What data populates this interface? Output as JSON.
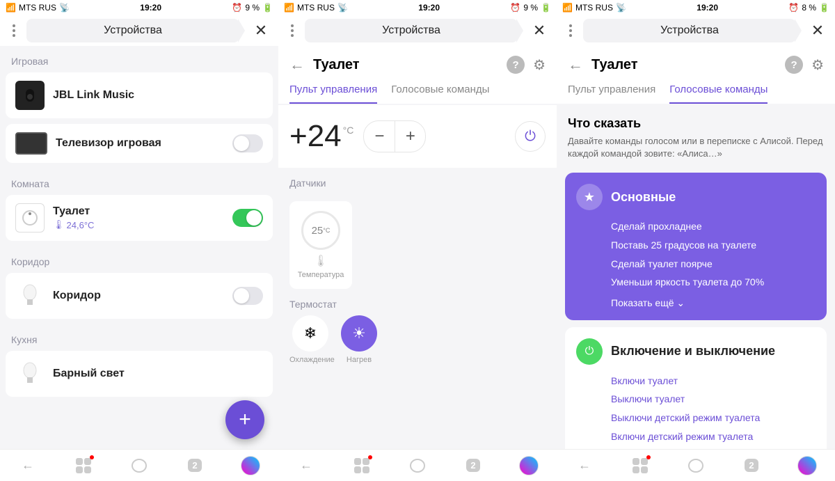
{
  "status": {
    "carrier": "MTS RUS",
    "time": "19:20",
    "battery1": "9 %",
    "battery2": "9 %",
    "battery3": "8 %"
  },
  "header": {
    "title": "Устройства"
  },
  "s1": {
    "groups": [
      {
        "label": "Игровая",
        "items": [
          {
            "name": "JBL Link Music",
            "icon": "speaker",
            "toggle": null
          },
          {
            "name": "Телевизор игровая",
            "icon": "tv",
            "toggle": false
          }
        ]
      },
      {
        "label": "Комната",
        "items": [
          {
            "name": "Туалет",
            "icon": "dial",
            "sub": "24,6°C",
            "toggle": true
          }
        ]
      },
      {
        "label": "Коридор",
        "items": [
          {
            "name": "Коридор",
            "icon": "bulb",
            "toggle": false
          }
        ]
      },
      {
        "label": "Кухня",
        "items": [
          {
            "name": "Барный свет",
            "icon": "bulb",
            "toggle": null
          }
        ]
      }
    ]
  },
  "s2": {
    "title": "Туалет",
    "tabs": {
      "remote": "Пульт управления",
      "voice": "Голосовые команды",
      "active": "remote"
    },
    "temp": {
      "value": "+24",
      "unit": "°C"
    },
    "sensors_label": "Датчики",
    "sensor": {
      "value": "25",
      "unit": "°C",
      "label": "Температура"
    },
    "thermo_label": "Термостат",
    "modes": {
      "cool": "Охлаждение",
      "heat": "Нагрев",
      "active": "heat"
    }
  },
  "s3": {
    "title": "Туалет",
    "tabs": {
      "remote": "Пульт управления",
      "voice": "Голосовые команды",
      "active": "voice"
    },
    "say": {
      "title": "Что сказать",
      "desc": "Давайте команды голосом или в переписке с Алисой. Перед каждой командой зовите: «Алиса…»"
    },
    "card1": {
      "title": "Основные",
      "items": [
        "Сделай прохладнее",
        "Поставь 25 градусов на туалете",
        "Сделай туалет поярче",
        "Уменьши яркость туалета до 70%"
      ],
      "more": "Показать ещё"
    },
    "card2": {
      "title": "Включение и выключение",
      "items": [
        "Включи туалет",
        "Выключи туалет",
        "Выключи детский режим туалета",
        "Включи детский режим туалета"
      ]
    }
  },
  "tabbar": {
    "count": "2"
  }
}
